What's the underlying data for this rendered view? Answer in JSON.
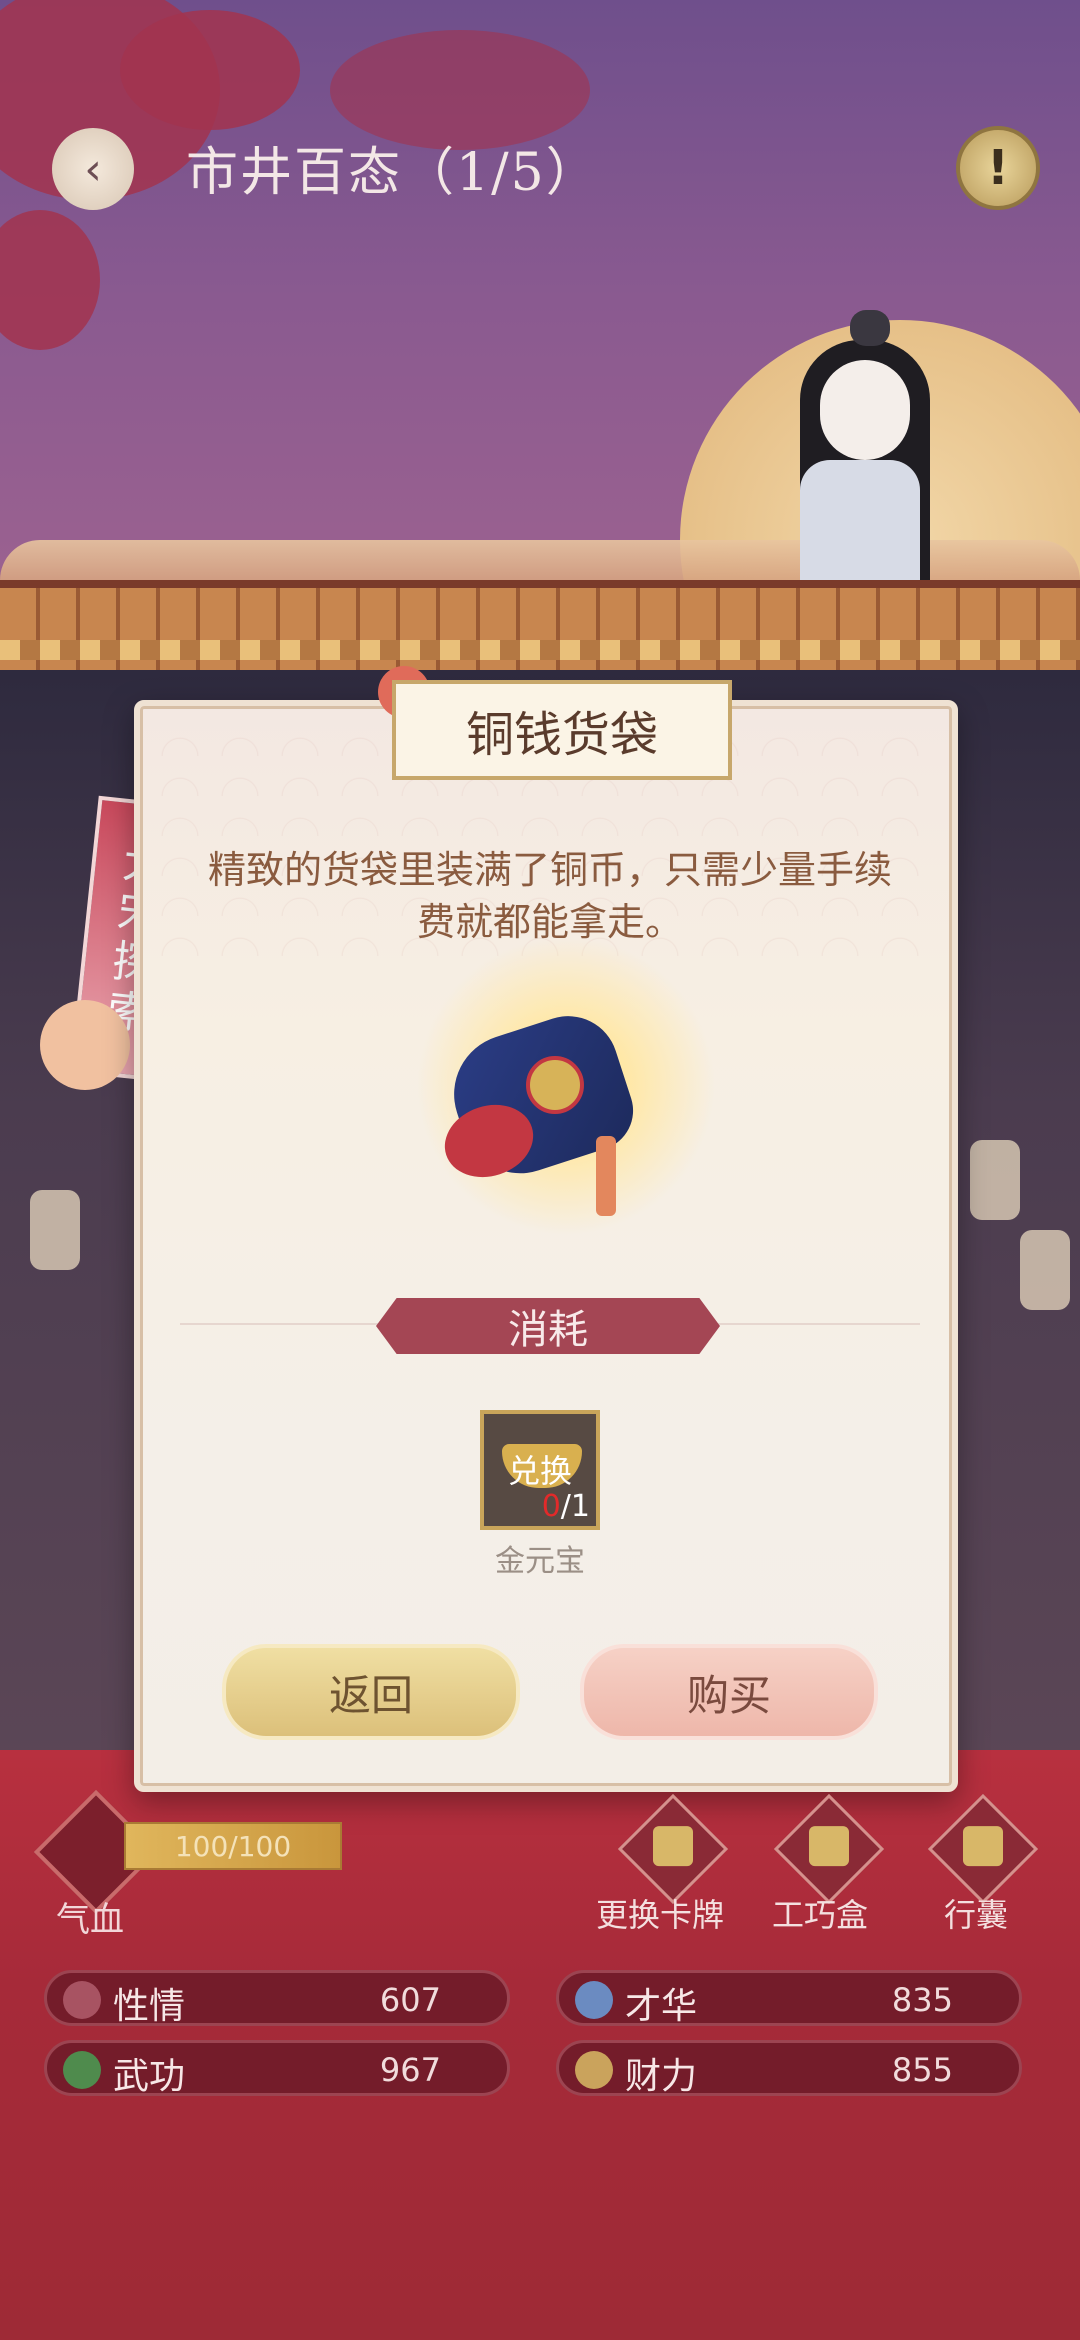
{
  "header": {
    "title": "市井百态（1/5）",
    "back_icon": "back-arrow-icon",
    "help_icon": "exclamation-icon",
    "help_symbol": "!"
  },
  "side_tag": {
    "text": "大宋探索"
  },
  "modal": {
    "title": "铜钱货袋",
    "description": "精致的货袋里装满了铜币，只需少量手续费就都能拿走。",
    "item_icon": "coin-pouch-icon",
    "consume_label": "消耗",
    "cost": {
      "tag": "兑换",
      "owned": "0",
      "required": "/1",
      "name": "金元宝",
      "icon": "gold-ingot-icon"
    },
    "buttons": {
      "back": "返回",
      "buy": "购买"
    }
  },
  "hud": {
    "hp": {
      "label": "气血",
      "value": "100/100",
      "icon": "blood-drop-icon",
      "progress": 1.0
    },
    "actions": [
      {
        "label": "更换卡牌",
        "icon": "card-icon"
      },
      {
        "label": "工巧盒",
        "icon": "scissors-icon"
      },
      {
        "label": "行囊",
        "icon": "bag-icon"
      }
    ]
  },
  "stats": [
    {
      "label": "性情",
      "value": "607",
      "icon": "flower-icon"
    },
    {
      "label": "才华",
      "value": "835",
      "icon": "fan-icon"
    },
    {
      "label": "武功",
      "value": "967",
      "icon": "sword-icon"
    },
    {
      "label": "财力",
      "value": "855",
      "icon": "coin-icon"
    }
  ],
  "colors": {
    "accent_red": "#a44654",
    "gold": "#d9b04f",
    "panel_bg": "#f7efe3"
  }
}
